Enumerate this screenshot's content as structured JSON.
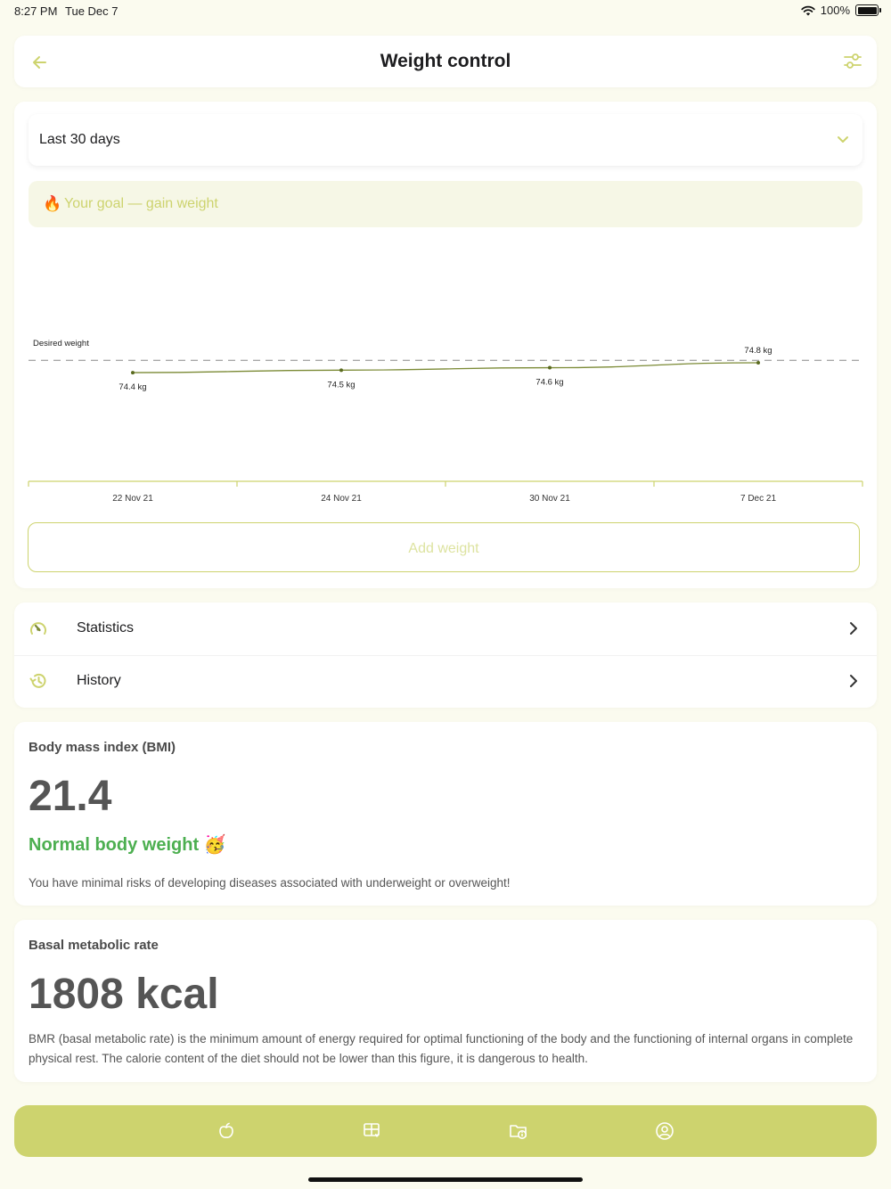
{
  "status_bar": {
    "time": "8:27 PM",
    "date": "Tue Dec 7",
    "battery": "100%"
  },
  "header": {
    "title": "Weight control"
  },
  "period_select": {
    "value": "Last 30 days"
  },
  "goal": {
    "text": "Your goal — gain weight"
  },
  "chart_data": {
    "type": "line",
    "x": [
      "22 Nov 21",
      "24 Nov 21",
      "30 Nov 21",
      "7 Dec 21"
    ],
    "series": [
      {
        "values": [
          74.4,
          74.5,
          74.6,
          74.8
        ]
      }
    ],
    "point_labels": [
      "74.4 kg",
      "74.5 kg",
      "74.6 kg",
      "74.8 kg"
    ],
    "reference_line": {
      "label": "Desired weight",
      "value": 74.9
    },
    "ylim": [
      70.0,
      79.6
    ]
  },
  "add_button": {
    "label": "Add weight"
  },
  "menu": {
    "statistics": "Statistics",
    "history": "History"
  },
  "bmi": {
    "title": "Body mass index (BMI)",
    "value": "21.4",
    "status": "Normal body weight",
    "description": "You have minimal risks of developing diseases associated with underweight or overweight!"
  },
  "bmr": {
    "title": "Basal metabolic rate",
    "value": "1808 kcal",
    "description": "BMR (basal metabolic rate) is the minimum amount of energy required for optimal functioning of the body and the functioning of internal organs in complete physical rest. The calorie content of the diet should not be lower than this figure, it is dangerous to health."
  },
  "colors": {
    "accent": "#cdd36e",
    "line": "#6b7a2a",
    "ok": "#4caf50"
  },
  "icons": {
    "back": "arrow-left-icon",
    "filter": "sliders-icon",
    "chevron": "chevron-down-icon",
    "stats": "gauge-icon",
    "history": "history-icon",
    "tabs": [
      "apple-icon",
      "meal-plan-icon",
      "calendar-info-icon",
      "profile-icon"
    ]
  }
}
